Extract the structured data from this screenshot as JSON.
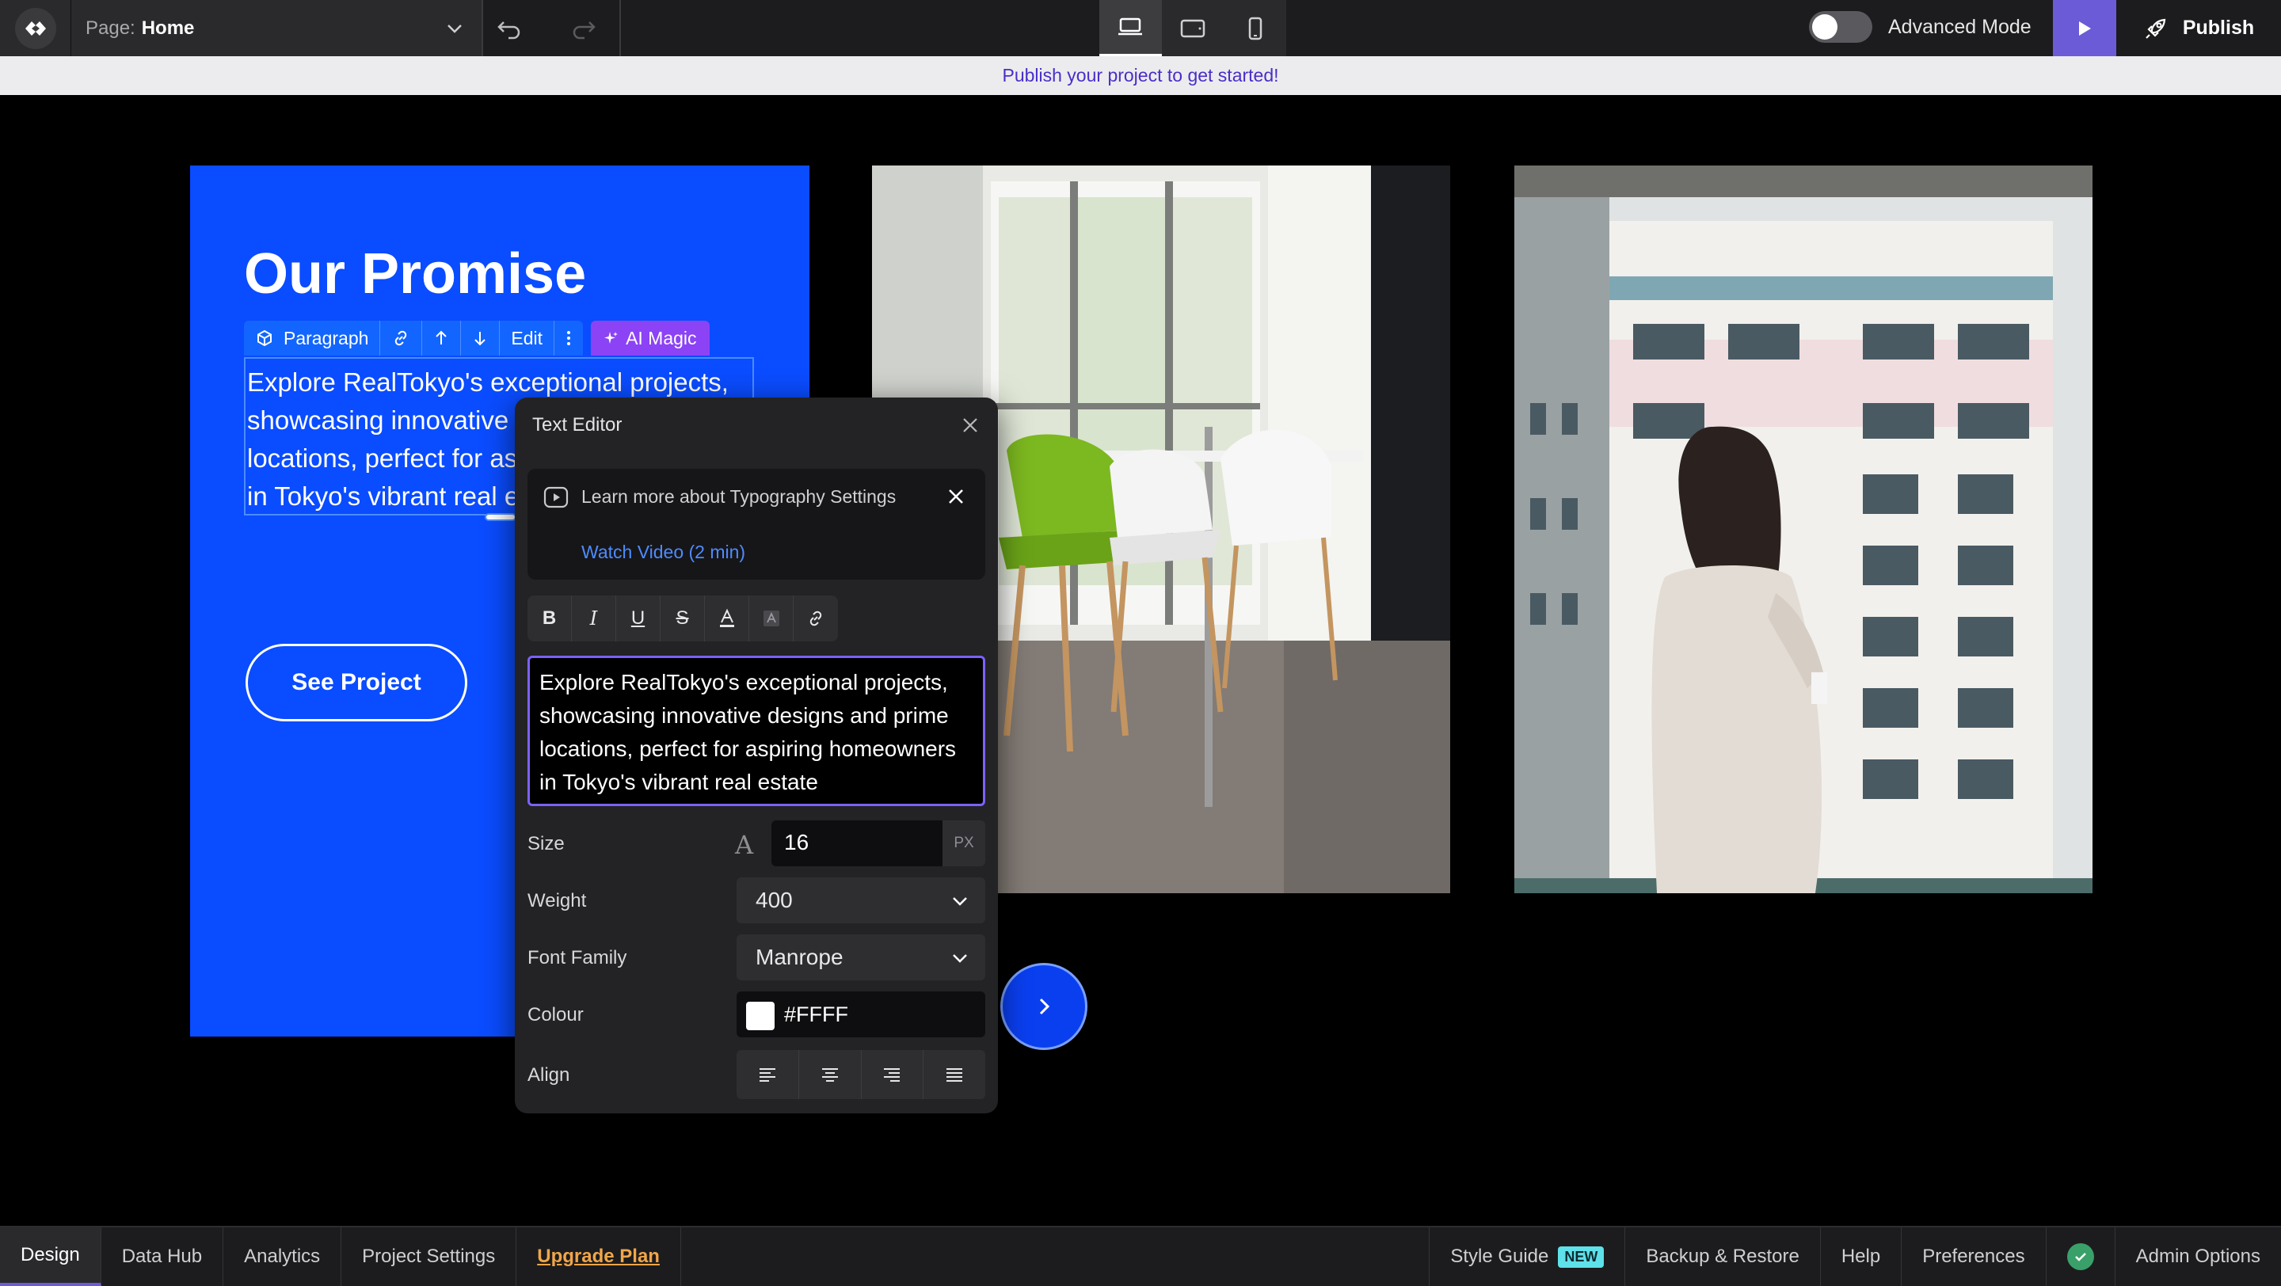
{
  "topbar": {
    "page_label": "Page:",
    "page_value": "Home",
    "advanced_mode_label": "Advanced Mode",
    "publish_label": "Publish"
  },
  "banner": {
    "text": "Publish your project to get started!"
  },
  "canvas": {
    "hero_title": "Our Promise",
    "paragraph": "Explore RealTokyo's exceptional projects, showcasing innovative designs and prime locations, perfect for aspiring homeowners in Tokyo's vibrant real estate",
    "see_project_label": "See Project"
  },
  "element_toolbar": {
    "type_label": "Paragraph",
    "edit_label": "Edit",
    "ai_magic_label": "AI Magic"
  },
  "text_editor": {
    "title": "Text Editor",
    "tip_text": "Learn more about Typography Settings",
    "tip_link": "Watch Video (2 min)",
    "content": "Explore RealTokyo's exceptional projects, showcasing innovative designs and prime locations, perfect for aspiring homeowners in Tokyo's vibrant real estate",
    "size_label": "Size",
    "size_value": "16",
    "size_unit": "PX",
    "weight_label": "Weight",
    "weight_value": "400",
    "font_family_label": "Font Family",
    "font_family_value": "Manrope",
    "colour_label": "Colour",
    "colour_value": "#FFFF",
    "align_label": "Align"
  },
  "bottombar": {
    "tabs": [
      "Design",
      "Data Hub",
      "Analytics",
      "Project Settings"
    ],
    "upgrade_label": "Upgrade Plan",
    "style_guide_label": "Style Guide",
    "new_badge": "NEW",
    "backup_label": "Backup & Restore",
    "help_label": "Help",
    "preferences_label": "Preferences",
    "admin_label": "Admin Options"
  },
  "colors": {
    "hero_blue": "#0a4cff",
    "accent_purple": "#6b5bd6",
    "ai_magic": "#8b43f5",
    "banner_text": "#4a2ec9",
    "upgrade": "#f0a64a"
  }
}
